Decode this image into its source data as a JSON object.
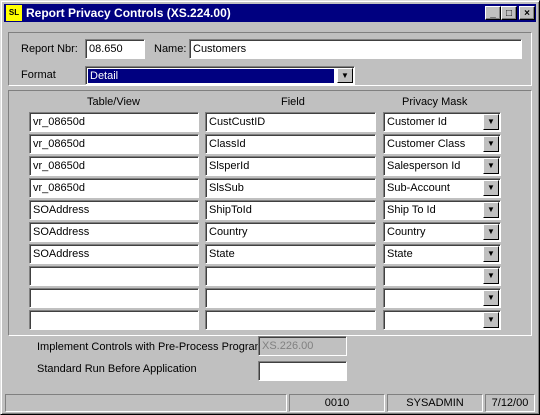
{
  "window": {
    "title": "Report Privacy Controls (XS.224.00)",
    "icon_text": "SL",
    "controls": {
      "minimize": "_",
      "maximize": "□",
      "close": "×"
    }
  },
  "header": {
    "report_nbr_label": "Report Nbr:",
    "report_nbr_value": "08.650",
    "name_label": "Name:",
    "name_value": "Customers",
    "format_label": "Format",
    "format_value": "Detail"
  },
  "grid": {
    "headers": {
      "table": "Table/View",
      "field": "Field",
      "mask": "Privacy Mask"
    },
    "rows": [
      {
        "table": "vr_08650d",
        "field": "CustCustID",
        "mask": "Customer Id"
      },
      {
        "table": "vr_08650d",
        "field": "ClassId",
        "mask": "Customer Class"
      },
      {
        "table": "vr_08650d",
        "field": "SlsperId",
        "mask": "Salesperson Id"
      },
      {
        "table": "vr_08650d",
        "field": "SlsSub",
        "mask": "Sub-Account"
      },
      {
        "table": "SOAddress",
        "field": "ShipToId",
        "mask": "Ship To Id"
      },
      {
        "table": "SOAddress",
        "field": "Country",
        "mask": "Country"
      },
      {
        "table": "SOAddress",
        "field": "State",
        "mask": "State"
      },
      {
        "table": "",
        "field": "",
        "mask": ""
      },
      {
        "table": "",
        "field": "",
        "mask": ""
      },
      {
        "table": "",
        "field": "",
        "mask": ""
      }
    ]
  },
  "footer": {
    "implement_label": "Implement Controls with Pre-Process Program",
    "implement_value": "XS.226.00",
    "standard_label": "Standard Run Before Application",
    "standard_value": ""
  },
  "statusbar": {
    "field1": "",
    "field2": "0010",
    "user": "SYSADMIN",
    "date": "7/12/00"
  }
}
